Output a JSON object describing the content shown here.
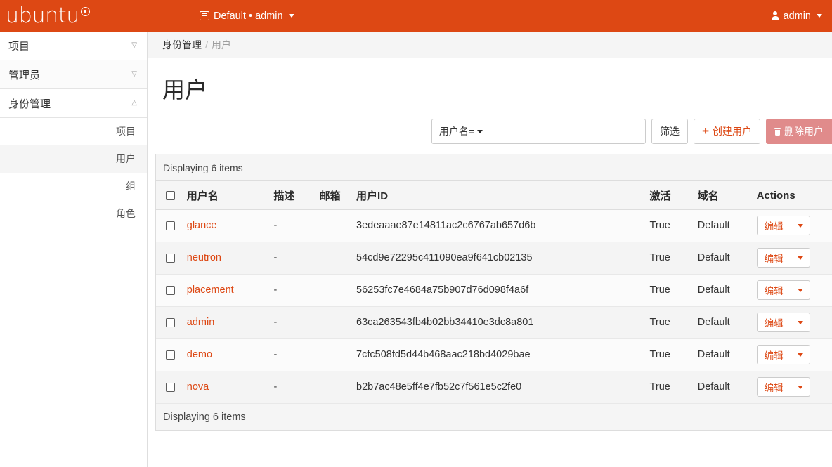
{
  "navbar": {
    "brand": "ubuntu",
    "brand_mark_icon": "ubuntu-circle-of-friends-icon",
    "context_icon": "list-lines-icon",
    "context_label": "Default • admin",
    "user_icon": "user-icon",
    "user_label": "admin",
    "background_color": "#dd4814"
  },
  "sidebar": {
    "groups": [
      {
        "label": "项目",
        "chevron": "chevron-down-icon"
      },
      {
        "label": "管理员",
        "chevron": "chevron-down-icon"
      },
      {
        "label": "身份管理",
        "chevron": "chevron-up-icon"
      }
    ],
    "sub_items": [
      {
        "label": "项目",
        "active": false
      },
      {
        "label": "用户",
        "active": true
      },
      {
        "label": "组",
        "active": false
      },
      {
        "label": "角色",
        "active": false
      }
    ]
  },
  "breadcrumb": {
    "parent": "身份管理",
    "separator": "/",
    "current": "用户"
  },
  "page": {
    "title": "用户"
  },
  "toolbar": {
    "filter_select_label": "用户名=",
    "filter_input_value": "",
    "filter_input_placeholder": "",
    "filter_button": "筛选",
    "create_button": "创建用户",
    "create_icon": "plus-icon",
    "delete_button": "删除用户",
    "delete_icon": "trash-icon",
    "delete_button_color": "#e08b8b",
    "accent_color": "#dd4814"
  },
  "table": {
    "header_count_label": "Displaying 6 items",
    "footer_count_label": "Displaying 6 items",
    "select_all_icon": "checkbox-icon",
    "columns": [
      "用户名",
      "描述",
      "邮箱",
      "用户ID",
      "激活",
      "域名",
      "Actions"
    ],
    "row_action_label": "编辑",
    "row_action_caret_icon": "caret-down-icon",
    "rows": [
      {
        "checkbox": "checkbox-icon",
        "name": "glance",
        "description": "-",
        "email": "",
        "user_id": "3edeaaae87e14811ac2c6767ab657d6b",
        "enabled": "True",
        "domain": "Default"
      },
      {
        "checkbox": "checkbox-icon",
        "name": "neutron",
        "description": "-",
        "email": "",
        "user_id": "54cd9e72295c411090ea9f641cb02135",
        "enabled": "True",
        "domain": "Default"
      },
      {
        "checkbox": "checkbox-icon",
        "name": "placement",
        "description": "-",
        "email": "",
        "user_id": "56253fc7e4684a75b907d76d098f4a6f",
        "enabled": "True",
        "domain": "Default"
      },
      {
        "checkbox": "checkbox-icon",
        "name": "admin",
        "description": "-",
        "email": "",
        "user_id": "63ca263543fb4b02bb34410e3dc8a801",
        "enabled": "True",
        "domain": "Default"
      },
      {
        "checkbox": "checkbox-icon",
        "name": "demo",
        "description": "-",
        "email": "",
        "user_id": "7cfc508fd5d44b468aac218bd4029bae",
        "enabled": "True",
        "domain": "Default"
      },
      {
        "checkbox": "checkbox-icon",
        "name": "nova",
        "description": "-",
        "email": "",
        "user_id": "b2b7ac48e5ff4e7fb52c7f561e5c2fe0",
        "enabled": "True",
        "domain": "Default"
      }
    ]
  }
}
